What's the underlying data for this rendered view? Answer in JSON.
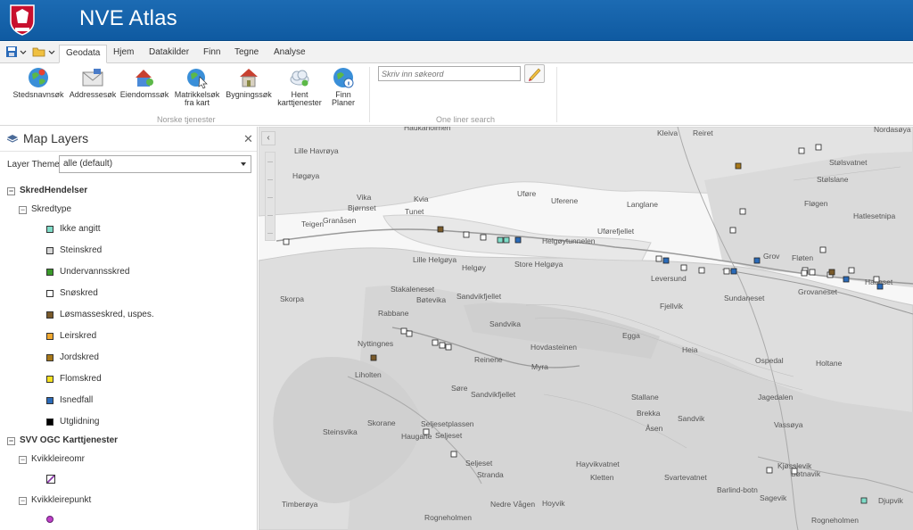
{
  "app": {
    "title": "NVE Atlas"
  },
  "ribbon": {
    "tabs": [
      {
        "label": "Geodata",
        "active": true
      },
      {
        "label": "Hjem"
      },
      {
        "label": "Datakilder"
      },
      {
        "label": "Finn"
      },
      {
        "label": "Tegne"
      },
      {
        "label": "Analyse"
      }
    ],
    "tools": [
      {
        "label": "Stedsnavnsøk",
        "icon": "globe-search-icon"
      },
      {
        "label": "Addressesøk",
        "icon": "envelope-icon"
      },
      {
        "label": "Eiendomssøk",
        "icon": "house-search-icon"
      },
      {
        "label": "Matrikkelsøk fra kart",
        "icon": "globe-click-icon"
      },
      {
        "label": "Bygningssøk",
        "icon": "building-icon"
      },
      {
        "label": "Hent karttjenester",
        "icon": "cloud-icon"
      },
      {
        "label": "Finn Planer",
        "icon": "globe-info-icon"
      }
    ],
    "group_norske": "Norske tjenester",
    "search_placeholder": "Skriv inn søkeord",
    "group_oneliner": "One liner search"
  },
  "panel": {
    "title": "Map Layers",
    "theme_label": "Layer Theme:",
    "theme_value": "alle (default)",
    "group1": "SkredHendelser",
    "group1_sub": "Skredtype",
    "legend": [
      {
        "label": "Ikke angitt",
        "color": "#7fdcc8"
      },
      {
        "label": "Steinskred",
        "color": "#d7d7d7"
      },
      {
        "label": "Undervannsskred",
        "color": "#3a9a2a"
      },
      {
        "label": "Snøskred",
        "color": "#ffffff"
      },
      {
        "label": "Løsmasseskred, uspes.",
        "color": "#7a5a2a"
      },
      {
        "label": "Leirskred",
        "color": "#f0a830"
      },
      {
        "label": "Jordskred",
        "color": "#a87818"
      },
      {
        "label": "Flomskred",
        "color": "#f4e020"
      },
      {
        "label": "Isnedfall",
        "color": "#2a6ab8"
      },
      {
        "label": "Utglidning",
        "color": "#000000"
      }
    ],
    "group2": "SVV OGC Karttjenester",
    "group2_sub1": "Kvikkleireomr",
    "group2_sub2": "Kvikkleirepunkt"
  },
  "map": {
    "place_labels": [
      "Haukaholmen",
      "Kleiva",
      "Reiret",
      "Nordasøya",
      "Lille Havrøya",
      "Høgøya",
      "Stølsvatnet",
      "Stølslane",
      "Vika",
      "Kvia",
      "Bjørnset",
      "Tunet",
      "Uferene",
      "Langlane",
      "Fløgen",
      "Teigen",
      "Granåsen",
      "Uføre",
      "Uførefjellet",
      "Helgøytunnelen",
      "Hatlesetnipa",
      "Lille Helgøya",
      "Helgøy",
      "Store Helgøya",
      "Grov",
      "Fløten",
      "Leversund",
      "Hatleset",
      "Skorpa",
      "Stakaleneset",
      "Bøtevika",
      "Sandvikfjellet",
      "Sundaneset",
      "Grovaneset",
      "Rabbane",
      "Fjellvik",
      "Sandvika",
      "Nyttingnes",
      "Hovdasteinen",
      "Egga",
      "Reinene",
      "Myra",
      "Heia",
      "Ospedal",
      "Holtane",
      "Liholten",
      "Søre",
      "Sandvikfjellet",
      "Stallane",
      "Jagedalen",
      "Brekka",
      "Sandvik",
      "Åsen",
      "Vassøya",
      "Skorane",
      "Seljesetplassen",
      "Seljeset",
      "Steinsvika",
      "Haugane",
      "Seljeset",
      "Stranda",
      "Hayvikvatnet",
      "Kletten",
      "Svartevatnet",
      "Kjøsslevik",
      "Hoyvik",
      "Timberøya",
      "Rogneholmen",
      "Nedre Vågen",
      "Bøtnavik",
      "Barlind-botn",
      "Sagevik",
      "Djupvik",
      "Rogneholmen"
    ]
  }
}
